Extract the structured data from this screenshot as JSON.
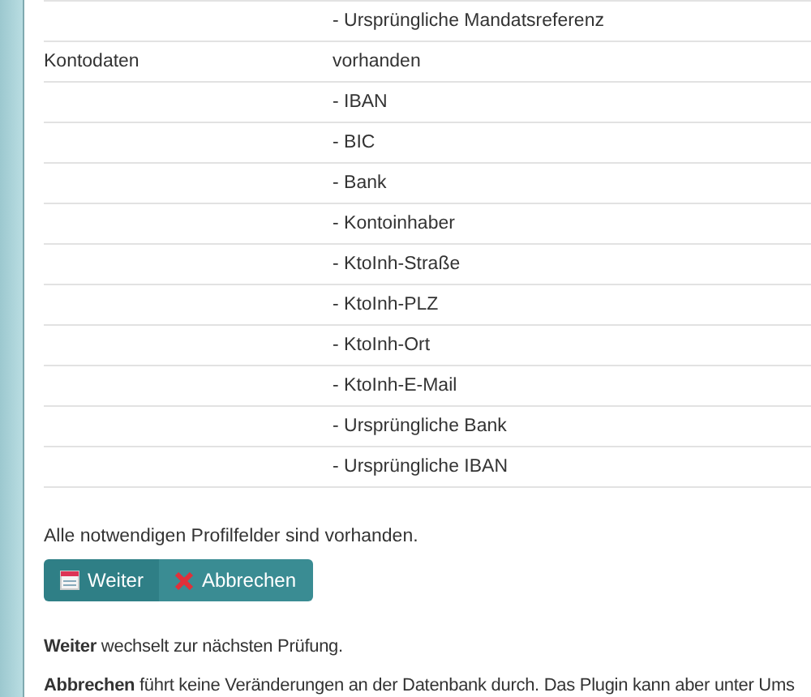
{
  "table": {
    "rows": [
      {
        "label": "",
        "value": "- Ursprüngliche Mandatsreferenz"
      },
      {
        "label": "Kontodaten",
        "value": "vorhanden"
      },
      {
        "label": "",
        "value": "- IBAN"
      },
      {
        "label": "",
        "value": "- BIC"
      },
      {
        "label": "",
        "value": "- Bank"
      },
      {
        "label": "",
        "value": "- Kontoinhaber"
      },
      {
        "label": "",
        "value": "- KtoInh-Straße"
      },
      {
        "label": "",
        "value": "- KtoInh-PLZ"
      },
      {
        "label": "",
        "value": "- KtoInh-Ort"
      },
      {
        "label": "",
        "value": "- KtoInh-E-Mail"
      },
      {
        "label": "",
        "value": "- Ursprüngliche Bank"
      },
      {
        "label": "",
        "value": "- Ursprüngliche IBAN"
      }
    ]
  },
  "status": "Alle notwendigen Profilfelder sind vorhanden.",
  "buttons": [
    {
      "kind": "next",
      "label": "Weiter"
    },
    {
      "kind": "cancel",
      "label": "Abbrechen"
    }
  ],
  "notes": [
    "**Weiter** wechselt zur nächsten Prüfung.",
    "**Abbrechen** führt keine Veränderungen an der Datenbank durch. Das Plugin kann aber unter Ums"
  ]
}
